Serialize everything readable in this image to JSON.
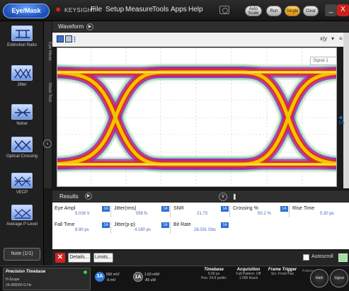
{
  "topbar": {
    "mode_button": "Eye/Mask",
    "brand": "KEYSIGHT",
    "menus": [
      "File",
      "Setup",
      "Measure",
      "Tools",
      "Apps",
      "Help"
    ],
    "pills": [
      "Auto Scale",
      "Run",
      "Single",
      "Clear"
    ],
    "window_buttons": [
      "_",
      "X"
    ]
  },
  "left_panel": {
    "tools": [
      {
        "label": "Extinction Ratio"
      },
      {
        "label": "Jitter"
      },
      {
        "label": "Noise"
      },
      {
        "label": "Optical Crossing"
      },
      {
        "label": "VECP"
      },
      {
        "label": "Average P Level"
      }
    ],
    "note_button": "Note (1/1)",
    "vtabs": [
      "Eye Meas",
      "Mask Test"
    ]
  },
  "waveform": {
    "title": "Waveform",
    "toolbar_right": [
      "x|y",
      "▾",
      "≡"
    ],
    "signal_label": "Signal 1",
    "level_marker": "◀ 1A"
  },
  "results": {
    "title": "Results",
    "rows": [
      [
        {
          "label": "Eye Ampl",
          "ch": "1A",
          "value": "5.016 V"
        },
        {
          "label": "Jitter(rms)",
          "ch": "1A",
          "value": "559 fs"
        },
        {
          "label": "SNR",
          "ch": "1A",
          "value": "21.73"
        },
        {
          "label": "Crossing %",
          "ch": "1A",
          "value": "50.2 %"
        },
        {
          "label": "Rise Time",
          "ch": "1A",
          "value": "5.30 ps"
        }
      ],
      [
        {
          "label": "Fall Time",
          "ch": "1A",
          "value": "8.90 ps"
        },
        {
          "label": "Jitter(p-p)",
          "ch": "1A",
          "value": "4.180 ps"
        },
        {
          "label": "Bit Rate",
          "ch": "1A",
          "value": "28.031 Gbs"
        }
      ]
    ],
    "footer": {
      "details": "Details...",
      "limits": "Limits...",
      "autoscroll": "Autoscroll"
    }
  },
  "status": {
    "precision_timebase": {
      "title": "Precision Timebase",
      "line1": "H-Scope",
      "line2": "24.000000 G Hz"
    },
    "channels": [
      {
        "name": "3A",
        "line1": "550 mV/",
        "line2": "-6 mV",
        "color": "#2f7bd8"
      },
      {
        "name": "1A",
        "line1": "1.03 mW/",
        "line2": "-85 uW",
        "color": "#555555"
      }
    ],
    "timebase": {
      "title": "Timebase",
      "line1": "0.00 ps",
      "line2": "Pos: 24.9 ps/div"
    },
    "acquisition": {
      "title": "Acquisition",
      "line1": "Full Pattern: Off",
      "line2": "1.000 Ksa/s"
    },
    "frame_trigger": {
      "title": "Frame Trigger",
      "line1": "Src: Front Pan"
    },
    "round_buttons": [
      "Math",
      "Signal"
    ],
    "extra_label": "Pattern"
  },
  "colors": {
    "accent": "#2d6fd8",
    "eye_core": "#f2c400",
    "eye_mid": "#e0301e",
    "eye_outer": "#a020c0",
    "eye_fringe": "#20a040"
  }
}
